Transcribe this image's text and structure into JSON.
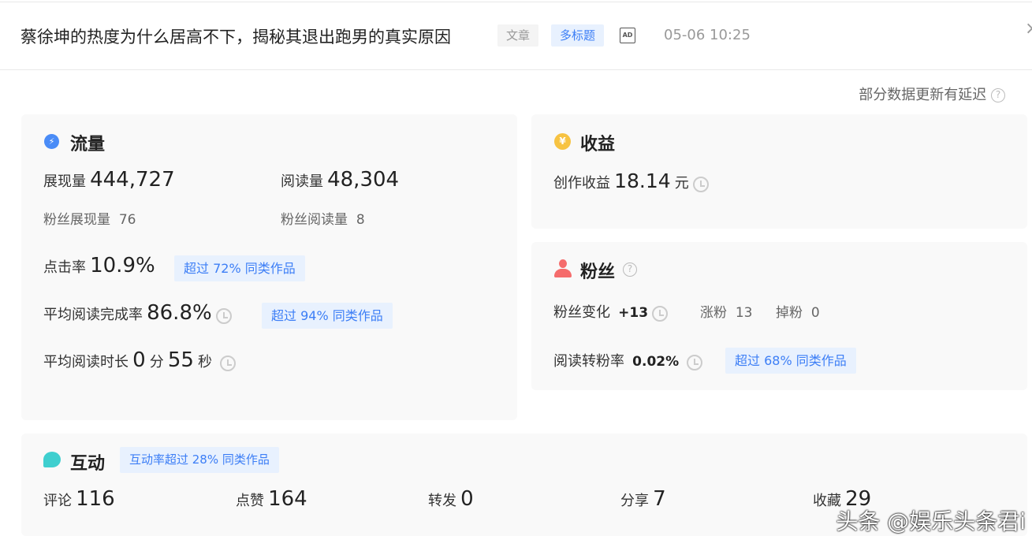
{
  "header": {
    "title": "蔡徐坤的热度为什么居高不下，揭秘其退出跑男的真实原因",
    "tag_type": "文章",
    "tag_multi": "多标题",
    "ad": "AD",
    "date": "05-06 10:25",
    "close": "×"
  },
  "notice": "部分数据更新有延迟",
  "traffic": {
    "title": "流量",
    "impressions_label": "展现量",
    "impressions": "444,727",
    "reads_label": "阅读量",
    "reads": "48,304",
    "fan_impr_label": "粉丝展现量",
    "fan_impr": "76",
    "fan_reads_label": "粉丝阅读量",
    "fan_reads": "8",
    "ctr_label": "点击率",
    "ctr": "10.9%",
    "ctr_badge": "超过 72% 同类作品",
    "completion_label": "平均阅读完成率",
    "completion": "86.8%",
    "completion_badge": "超过 94% 同类作品",
    "duration_label": "平均阅读时长",
    "duration_min": "0",
    "min_unit": "分",
    "duration_sec": "55",
    "sec_unit": "秒"
  },
  "income": {
    "title": "收益",
    "label": "创作收益",
    "value": "18.14",
    "unit": "元"
  },
  "fans": {
    "title": "粉丝",
    "change_label": "粉丝变化",
    "change": "+13",
    "gain_label": "涨粉",
    "gain": "13",
    "loss_label": "掉粉",
    "loss": "0",
    "conv_label": "阅读转粉率",
    "conv": "0.02%",
    "conv_badge": "超过 68% 同类作品"
  },
  "interaction": {
    "title": "互动",
    "badge": "互动率超过 28% 同类作品",
    "items": [
      {
        "label": "评论",
        "value": "116"
      },
      {
        "label": "点赞",
        "value": "164"
      },
      {
        "label": "转发",
        "value": "0"
      },
      {
        "label": "分享",
        "value": "7"
      },
      {
        "label": "收藏",
        "value": "29"
      }
    ]
  },
  "watermark": "头条 @娱乐头条君i",
  "colors": {
    "accent": "#3c7ef6",
    "badge_bg": "#e8f1fe",
    "traffic_icon": "#4a8cf7",
    "income_icon": "#f7c342",
    "fans_icon": "#f56c6c",
    "interaction_icon": "#3fcfcf"
  }
}
